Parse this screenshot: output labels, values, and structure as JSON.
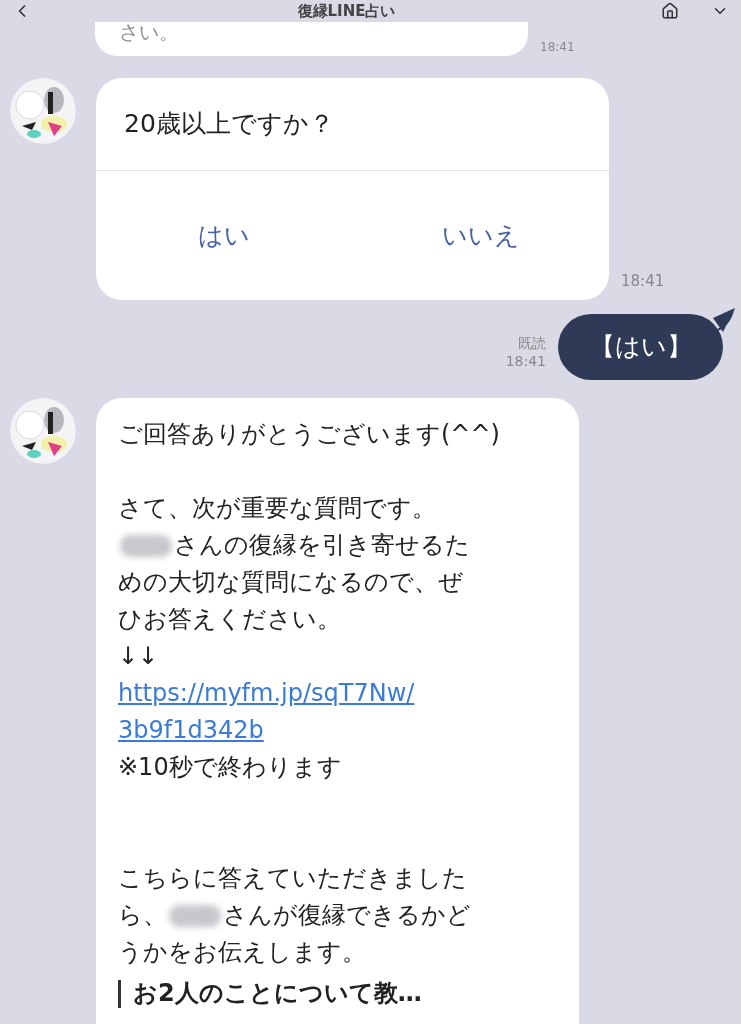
{
  "header": {
    "title": "復縁LINE占い"
  },
  "previous": {
    "text": "さい。",
    "time": "18:41"
  },
  "question": {
    "text": "20歳以上ですか？",
    "options": [
      "はい",
      "いいえ"
    ],
    "time": "18:41"
  },
  "reply": {
    "text": "【はい】",
    "read": "既読",
    "time": "18:41"
  },
  "message": {
    "lines": [
      {
        "kind": "text",
        "parts": [
          {
            "kind": "text",
            "text": "ご回答ありがとうございます(^^)"
          }
        ]
      },
      {
        "kind": "blank"
      },
      {
        "kind": "text",
        "parts": [
          {
            "kind": "text",
            "text": "さて、次が重要な質問です。"
          }
        ]
      },
      {
        "kind": "text",
        "parts": [
          {
            "kind": "redacted"
          },
          {
            "kind": "text",
            "text": "さんの復縁を引き寄せるた"
          }
        ]
      },
      {
        "kind": "text",
        "parts": [
          {
            "kind": "text",
            "text": "めの大切な質問になるので、ぜ"
          }
        ]
      },
      {
        "kind": "text",
        "parts": [
          {
            "kind": "text",
            "text": "ひお答えください。"
          }
        ]
      },
      {
        "kind": "text",
        "parts": [
          {
            "kind": "text",
            "text": "↓↓"
          }
        ]
      },
      {
        "kind": "link",
        "parts": [
          {
            "kind": "text",
            "text": "https://myfm.jp/sqT7Nw/"
          }
        ]
      },
      {
        "kind": "link",
        "parts": [
          {
            "kind": "text",
            "text": "3b9f1d342b"
          }
        ]
      },
      {
        "kind": "text",
        "parts": [
          {
            "kind": "text",
            "text": "※10秒で終わります"
          }
        ]
      },
      {
        "kind": "blank"
      },
      {
        "kind": "blank"
      },
      {
        "kind": "text",
        "parts": [
          {
            "kind": "text",
            "text": "こちらに答えていただきました"
          }
        ]
      },
      {
        "kind": "text",
        "parts": [
          {
            "kind": "text",
            "text": "ら、"
          },
          {
            "kind": "redacted"
          },
          {
            "kind": "text",
            "text": "さんが復縁できるかど"
          }
        ]
      },
      {
        "kind": "text",
        "parts": [
          {
            "kind": "text",
            "text": "うかをお伝えします。"
          }
        ]
      },
      {
        "kind": "quote",
        "parts": [
          {
            "kind": "text",
            "text": "お2人のことについて教…"
          }
        ]
      }
    ]
  }
}
